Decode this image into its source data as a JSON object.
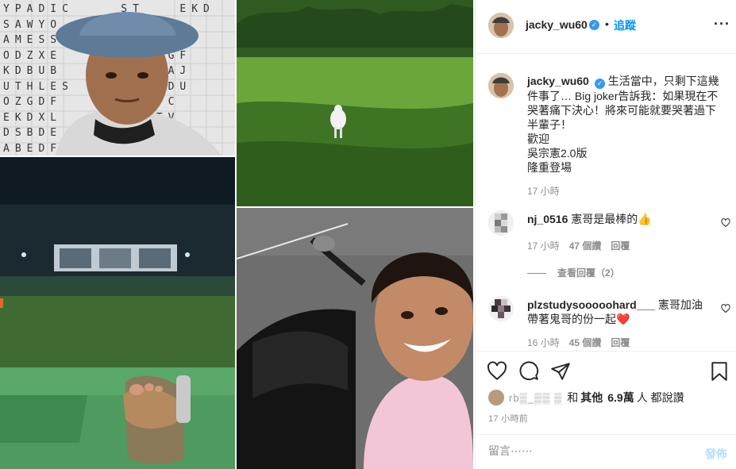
{
  "photos": {
    "letter_grid": "YPADIC    ST   EKD\nSAWYO       WC\nAMESS       GPWB\nODZXE       FRGF\nKDBUB       SWAJ\nUTHLES     ESRDU\nOZGDF     PISTC\nEKDXL     OMYTV\nDSBDE      IMYJ\nABEDF      TLQFN\nYEEGU      RDGEV",
    "items": [
      {
        "icon": "selfie-with-letter-wall"
      },
      {
        "icon": "golf-course-child"
      },
      {
        "icon": "driving-range-night"
      },
      {
        "icon": "motorcycle-selfie"
      }
    ]
  },
  "header": {
    "username": "jacky_wu60",
    "verified_glyph": "✓",
    "separator": "•",
    "follow_label": "追蹤",
    "more_label": "···"
  },
  "caption": {
    "username": "jacky_wu60",
    "lines": [
      "生活當中，只剩下這幾件事了… Big joker告訴我：如果現在不哭著痛下決心！將來可能就要哭著過下半輩子！",
      "歡迎",
      "吳宗憲2.0版",
      "隆重登場"
    ],
    "time": "17 小時"
  },
  "comments": [
    {
      "username": "nj_0516",
      "text": "憲哥是最棒的👍",
      "time": "17 小時",
      "likes": "47 個讚",
      "reply": "回覆",
      "view_replies": "查看回覆（2）"
    },
    {
      "username": "plzstudysooooohard___",
      "text": "憲哥加油帶著鬼哥的份一起❤️",
      "time": "16 小時",
      "likes": "45 個讚",
      "reply": "回覆"
    }
  ],
  "actions": {
    "liked_by_name": "rb▒_▒▒ ▒",
    "liked_by_joiner": "和",
    "others_label": "其他",
    "others_count": "6.9萬",
    "others_suffix": "人 都說讚",
    "post_time": "17 小時前"
  },
  "composer": {
    "placeholder": "留言⋯⋯",
    "post_label": "發佈"
  },
  "colors": {
    "accent": "#0095f6",
    "verified": "#3897f0",
    "muted": "#8e8e8e",
    "post_disabled": "#b2dffc",
    "heart": "#ed4956"
  }
}
